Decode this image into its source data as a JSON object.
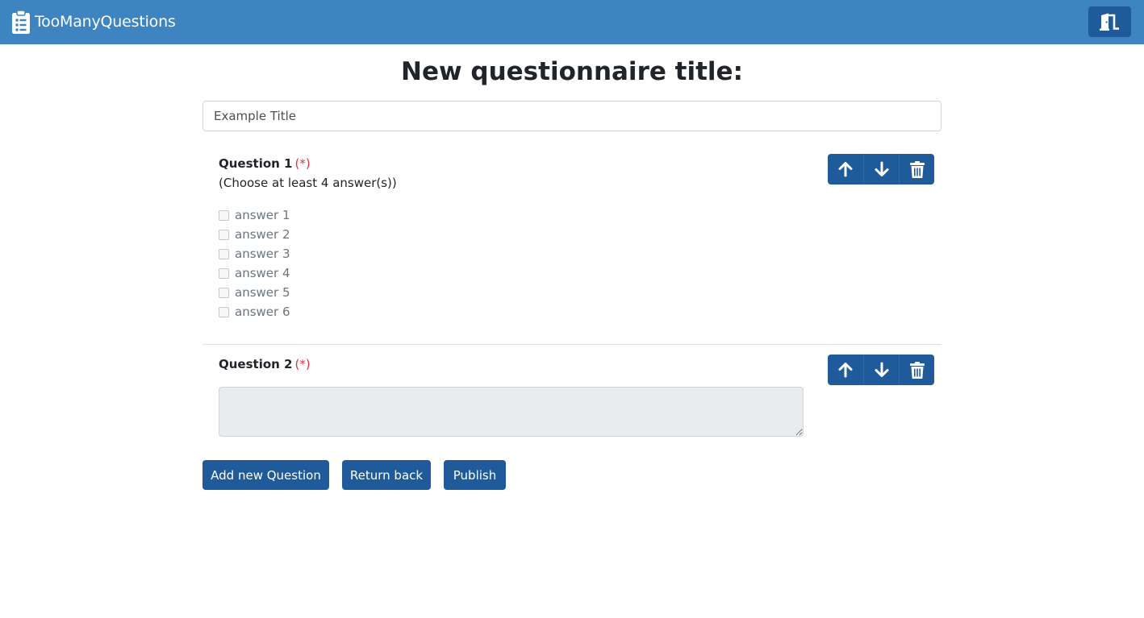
{
  "navbar": {
    "brand": "TooManyQuestions",
    "brand_icon": "clipboard-list-icon",
    "exit_icon": "door-exit-icon",
    "background": "#3d84c1"
  },
  "page": {
    "title": "New questionnaire title:",
    "title_input_value": "Example Title"
  },
  "questions": [
    {
      "label": "Question 1",
      "required_mark": "(*)",
      "hint": "(Choose at least 4 answer(s))",
      "answers": [
        "answer 1",
        "answer 2",
        "answer 3",
        "answer 4",
        "answer 5",
        "answer 6"
      ]
    },
    {
      "label": "Question 2",
      "required_mark": "(*)",
      "textarea_value": ""
    }
  ],
  "question_controls": [
    "arrow-up-icon",
    "arrow-down-icon",
    "trash-icon"
  ],
  "actions": {
    "add": "Add new Question",
    "back": "Return back",
    "publish": "Publish"
  },
  "colors": {
    "primary_button": "#1f5b9a",
    "required": "#dc3545"
  }
}
